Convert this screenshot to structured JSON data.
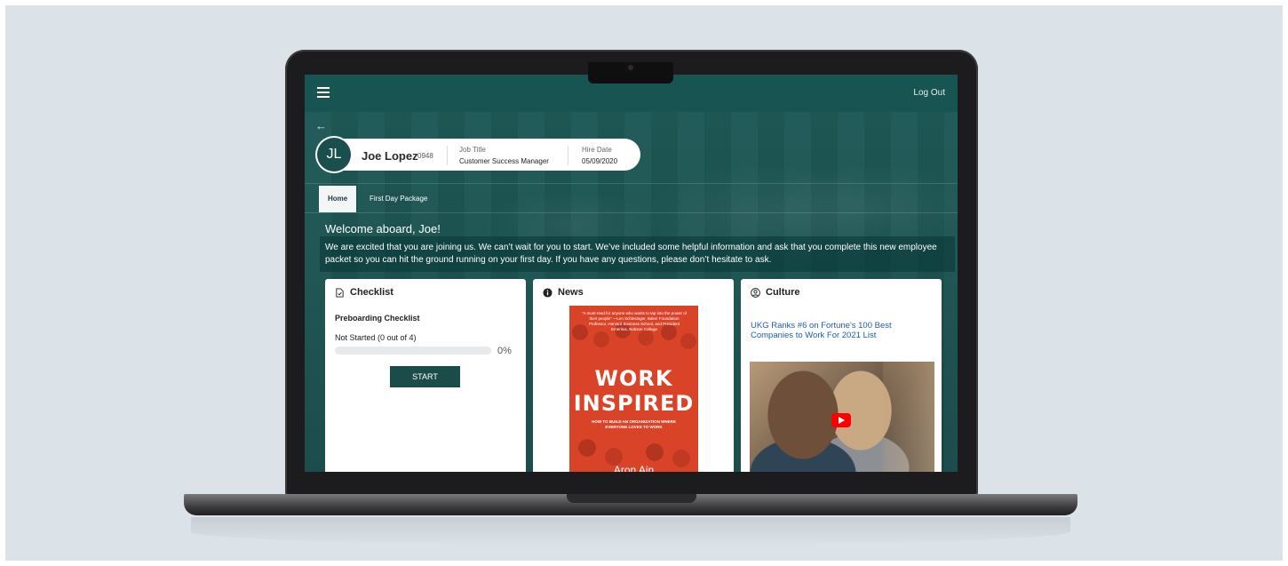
{
  "header": {
    "logout_label": "Log Out"
  },
  "employee": {
    "initials": "JL",
    "name": "Joe Lopez",
    "id": "0948",
    "job_title_label": "Job Title",
    "job_title": "Customer Success Manager",
    "hire_date_label": "Hire Date",
    "hire_date": "05/09/2020"
  },
  "tabs": [
    {
      "label": "Home",
      "active": true
    },
    {
      "label": "First Day Package",
      "active": false
    }
  ],
  "welcome": {
    "title": "Welcome aboard, Joe!",
    "message": "We are excited that you are joining us. We can’t wait for you to start. We’ve included some helpful information and ask that you complete this new employee packet so you can hit the ground running on your first day. If you have any questions, please don’t hesitate to ask."
  },
  "checklist": {
    "title": "Checklist",
    "subtitle": "Preboarding Checklist",
    "status": "Not Started (0 out of 4)",
    "progress_percent": 0,
    "progress_label": "0%",
    "start_label": "START"
  },
  "news": {
    "title": "News",
    "book": {
      "quote": "\"A must-read for anyone who wants to tap into the power of their people\" —Len Schlesinger, Baker Foundation Professor, Harvard Business School, and President Emeritus, Babson College",
      "title_line1": "WORK",
      "title_line2": "INSPIRED",
      "subtitle": "HOW TO BUILD AN ORGANIZATION WHERE EVERYONE LOVES TO WORK",
      "author": "Aron Ain"
    }
  },
  "culture": {
    "title": "Culture",
    "link_text": "UKG Ranks #6 on Fortune's 100 Best Companies to Work For 2021 List"
  },
  "colors": {
    "brand_teal": "#175452",
    "link_blue": "#1c5fa8",
    "book_red": "#d94429",
    "youtube_red": "#ff0000"
  },
  "icons": {
    "menu": "hamburger-icon",
    "back": "back-arrow-icon",
    "checklist": "document-check-icon",
    "news": "info-circle-icon",
    "culture": "person-circle-icon",
    "video": "play-icon"
  }
}
